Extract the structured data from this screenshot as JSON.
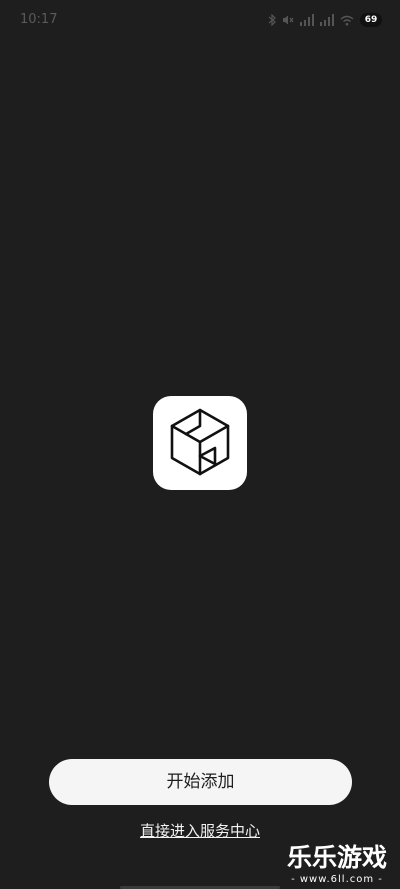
{
  "status_bar": {
    "time": "10:17",
    "battery_level": "69",
    "icons": [
      "bluetooth-icon",
      "mute-icon",
      "signal-icon",
      "signal-icon",
      "wifi-icon",
      "battery-icon"
    ]
  },
  "logo": {
    "icon": "hexagon-cube-logo",
    "background_color": "#ffffff",
    "stroke_color": "#111111"
  },
  "actions": {
    "start_add_label": "开始添加",
    "service_center_link": "直接进入服务中心"
  },
  "watermark": {
    "title": "乐乐游戏",
    "url": "- www.6ll.com -"
  },
  "colors": {
    "background": "#1e1e1e",
    "button_background": "#f5f5f5",
    "button_text": "#1e1e1e",
    "link_text": "#f2f2f2"
  }
}
